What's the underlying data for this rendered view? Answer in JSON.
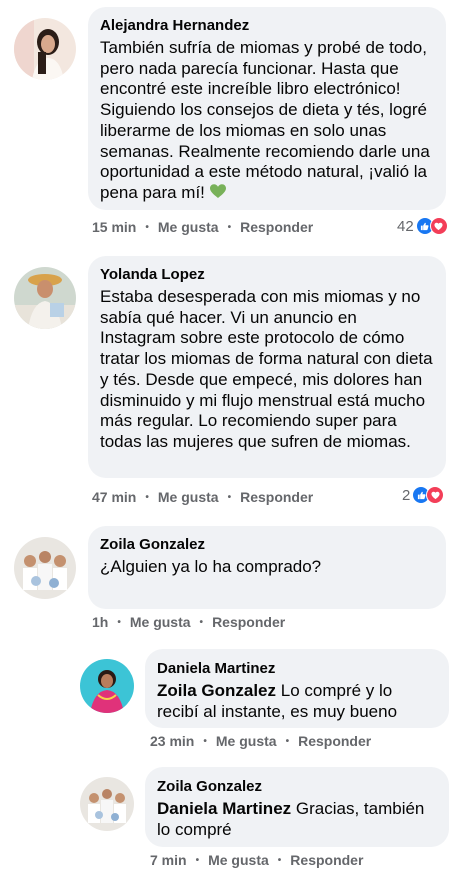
{
  "comments": [
    {
      "author": "Alejandra Hernandez",
      "text": "También sufría de miomas y probé de todo, pero nada parecía funcionar. Hasta que encontré este increíble libro electrónico! Siguiendo los consejos de dieta y tés, logré liberarme de los miomas en solo unas semanas. Realmente recomiendo darle una oportunidad a este método natural, ¡valió la pena para mí!",
      "emoji": "green-heart",
      "time": "15 min",
      "like": "Me gusta",
      "reply": "Responder",
      "reaction_count": "42"
    },
    {
      "author": "Yolanda Lopez",
      "text": "Estaba desesperada con mis miomas y no sabía qué hacer. Vi un anuncio en Instagram sobre este protocolo de cómo tratar los miomas de forma natural con dieta y tés. Desde que empecé, mis dolores han disminuido y mi flujo menstrual está mucho más regular. Lo recomiendo super para todas las mujeres que sufren de miomas.",
      "time": "47 min",
      "like": "Me gusta",
      "reply": "Responder",
      "reaction_count": "2"
    },
    {
      "author": "Zoila Gonzalez",
      "text": "¿Alguien ya lo ha comprado?",
      "time": "1h",
      "like": "Me gusta",
      "reply": "Responder"
    }
  ],
  "replies": [
    {
      "author": "Daniela Martinez",
      "mention": "Zoila Gonzalez",
      "text": "Lo compré y lo recibí al instante, es muy bueno",
      "time": "23 min",
      "like": "Me gusta",
      "reply": "Responder"
    },
    {
      "author": "Zoila Gonzalez",
      "mention": "Daniela Martinez",
      "text": "Gracias, también lo compré",
      "time": "7 min",
      "like": "Me gusta",
      "reply": "Responder"
    }
  ],
  "icons": {
    "like": "thumbs-up-icon",
    "love": "heart-icon"
  },
  "colors": {
    "bubble": "#f0f2f5",
    "secondary_text": "#65676b",
    "like_blue": "#1877f2",
    "love_red": "#f33e58",
    "green_heart": "#78b159"
  }
}
